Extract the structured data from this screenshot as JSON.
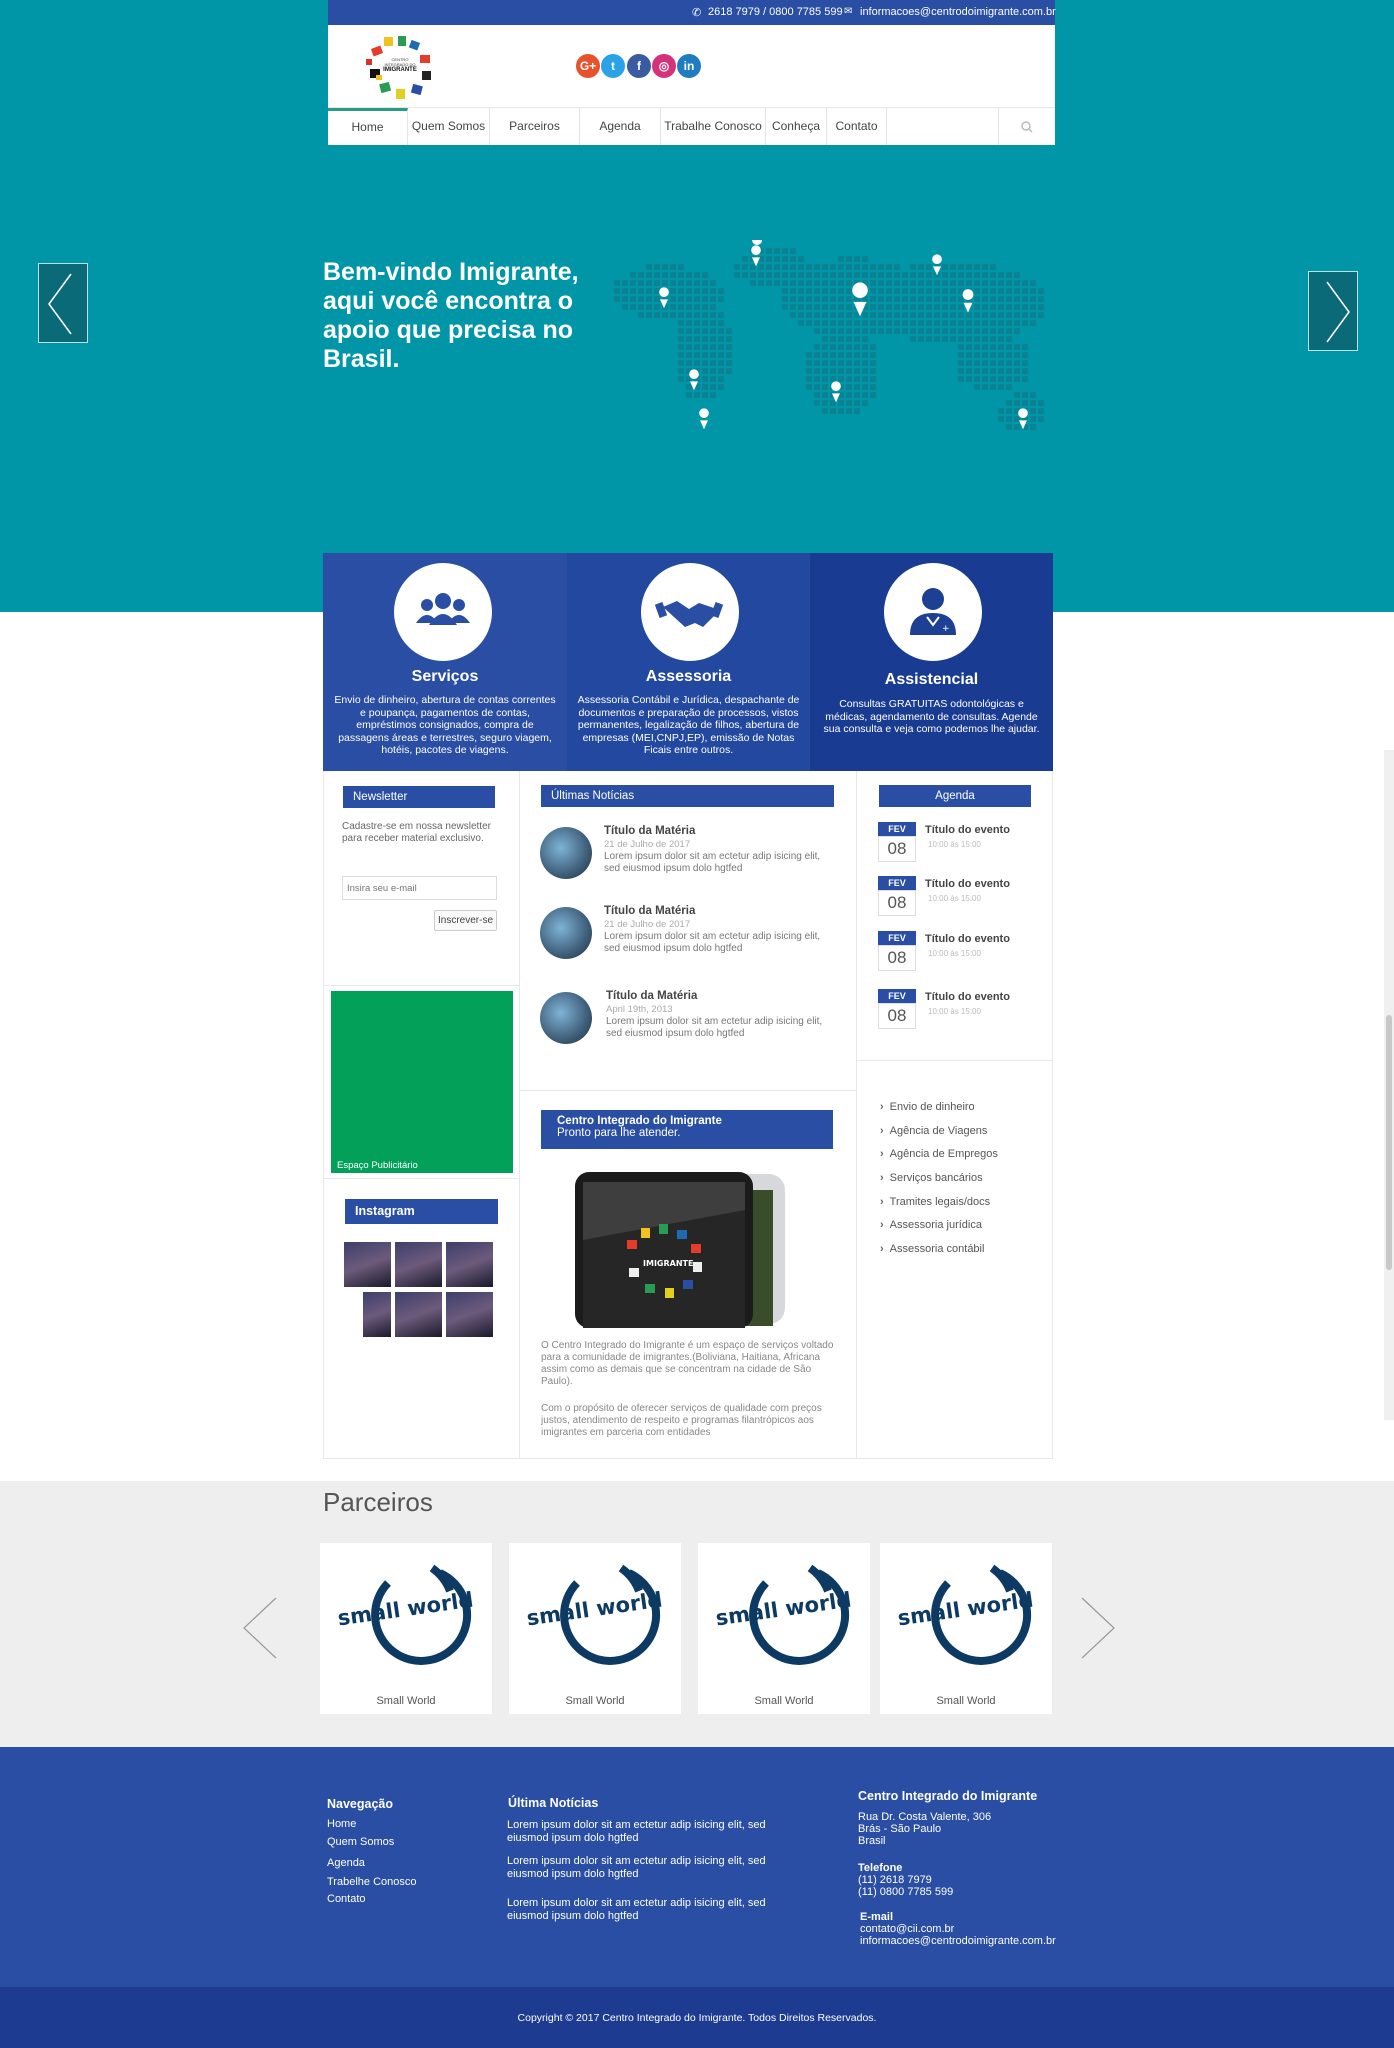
{
  "topbar": {
    "phone": "2618 7979 / 0800 7785 599",
    "email": "informacoes@centrodoimigrante.com.br"
  },
  "logo": {
    "text_top": "CENTRO",
    "text_mid": "INTEGRADO DO",
    "text_main": "IMIGRANTE"
  },
  "social": [
    {
      "name": "google-plus-icon",
      "glyph": "G+",
      "color": "#e8522a"
    },
    {
      "name": "twitter-icon",
      "glyph": "t",
      "color": "#2aa3e6"
    },
    {
      "name": "facebook-icon",
      "glyph": "f",
      "color": "#3a5ba0"
    },
    {
      "name": "instagram-icon",
      "glyph": "◎",
      "color": "#d6327a"
    },
    {
      "name": "linkedin-icon",
      "glyph": "in",
      "color": "#1f7cc1"
    }
  ],
  "nav": [
    "Home",
    "Quem Somos",
    "Parceiros",
    "Agenda",
    "Trabalhe Conosco",
    "Conheça",
    "Contato"
  ],
  "hero": {
    "headline": "Bem-vindo Imigrante, aqui você encontra o apoio que precisa no Brasil."
  },
  "features": [
    {
      "title": "Serviços",
      "icon": "people-group-icon",
      "text": "Envio de dinheiro, abertura de contas correntes e poupança, pagamentos de contas, empréstimos consignados, compra de passagens áreas e terrestres, seguro viagem, hotéis, pacotes de viagens."
    },
    {
      "title": "Assessoria",
      "icon": "handshake-icon",
      "text": "Assessoria Contábil e Jurídica, despachante de documentos e preparação de processos, vistos permanentes, legalização de filhos, abertura de empresas (MEI,CNPJ,EP), emissão de Notas Ficais entre outros."
    },
    {
      "title": "Assistencial",
      "icon": "doctor-icon",
      "text": "Consultas GRATUITAS odontológicas e médicas, agendamento de consultas. Agende sua consulta e veja como podemos lhe ajudar."
    }
  ],
  "newsletter": {
    "title": "Newsletter",
    "text": "Cadastre-se em nossa newsletter para receber material exclusivo.",
    "placeholder": "Insira seu e-mail",
    "button": "Inscrever-se"
  },
  "ad": {
    "label": "Espaço Publicitário"
  },
  "instagram": {
    "title": "Instagram"
  },
  "news": {
    "title": "Últimas Notícias",
    "items": [
      {
        "title": "Título da Matéria",
        "date": "21 de Julho de 2017",
        "text": "Lorem ipsum dolor sit am ectetur adip isicing elit, sed eiusmod ipsum dolo hgtfed"
      },
      {
        "title": "Título da Matéria",
        "date": "21 de Julho de 2017",
        "text": "Lorem ipsum dolor sit am ectetur adip isicing elit, sed eiusmod ipsum dolo hgtfed"
      },
      {
        "title": "Título da Matéria",
        "date": "April 19th, 2013",
        "text": "Lorem ipsum dolor sit am ectetur adip isicing elit, sed eiusmod ipsum dolo hgtfed"
      }
    ]
  },
  "promo": {
    "title": "Centro Integrado do Imigrante",
    "subtitle": "Pronto para lhe atender.",
    "p1": "O Centro Integrado do Imigrante é um espaço de serviços voltado para a comunidade de imigrantes.(Boliviana, Haitiana, Africana assim como as demais que se concentram na cidade de São Paulo).",
    "p2": "Com o propósito de oferecer serviços de qualidade com preços justos, atendimento de respeito e programas filantrópicos aos imigrantes em parceria com entidades"
  },
  "agenda": {
    "title": "Agenda",
    "items": [
      {
        "month": "FEV",
        "day": "08",
        "title": "Título do evento",
        "time": "10:00 às 15:00"
      },
      {
        "month": "FEV",
        "day": "08",
        "title": "Título do evento",
        "time": "10:00 às 15:00"
      },
      {
        "month": "FEV",
        "day": "08",
        "title": "Título do evento",
        "time": "10:00 às 15:00"
      },
      {
        "month": "FEV",
        "day": "08",
        "title": "Título do evento",
        "time": "10:00 às 15:00"
      }
    ]
  },
  "services": [
    "Envio de dinheiro",
    "Agência de Viagens",
    "Agência de Empregos",
    "Serviços bancários",
    "Tramites legais/docs",
    "Assessoria jurídica",
    "Assessoria contábil"
  ],
  "partners": {
    "title": "Parceiros",
    "items": [
      {
        "logo": "small world",
        "name": "Small World"
      },
      {
        "logo": "small world",
        "name": "Small World"
      },
      {
        "logo": "small world",
        "name": "Small World"
      },
      {
        "logo": "small world",
        "name": "Small World"
      }
    ]
  },
  "footer": {
    "nav_title": "Navegação",
    "nav": [
      "Home",
      "Quem Somos",
      "Agenda",
      "Trabelhe Conosco",
      "Contato"
    ],
    "news_title": "Última Notícias",
    "news": [
      "Lorem ipsum dolor sit am ectetur adip isicing elit, sed eiusmod ipsum dolo hgtfed",
      "Lorem ipsum dolor sit am ectetur adip isicing elit, sed eiusmod ipsum dolo hgtfed",
      "Lorem ipsum dolor sit am ectetur adip isicing elit, sed eiusmod ipsum dolo hgtfed"
    ],
    "org_title": "Centro Integrado do Imigrante",
    "address": [
      "Rua Dr. Costa Valente, 306",
      "Brás - São Paulo",
      "Brasil"
    ],
    "phone_title": "Telefone",
    "phones": [
      "(11) 2618 7979",
      "(11) 0800 7785 599"
    ],
    "email_title": "E-mail",
    "emails": [
      "contato@cii.com.br",
      "informacoes@centrodoimigrante.com.br"
    ],
    "copyright": "Copyright © 2017  Centro Integrado do Imigrante. Todos Direitos Reservados."
  },
  "colors": {
    "teal": "#0096a8",
    "blue": "#2a4ea3",
    "blue_dark": "#1d3f94",
    "green": "#03a05a",
    "footer_bottom": "#1d3b91"
  }
}
